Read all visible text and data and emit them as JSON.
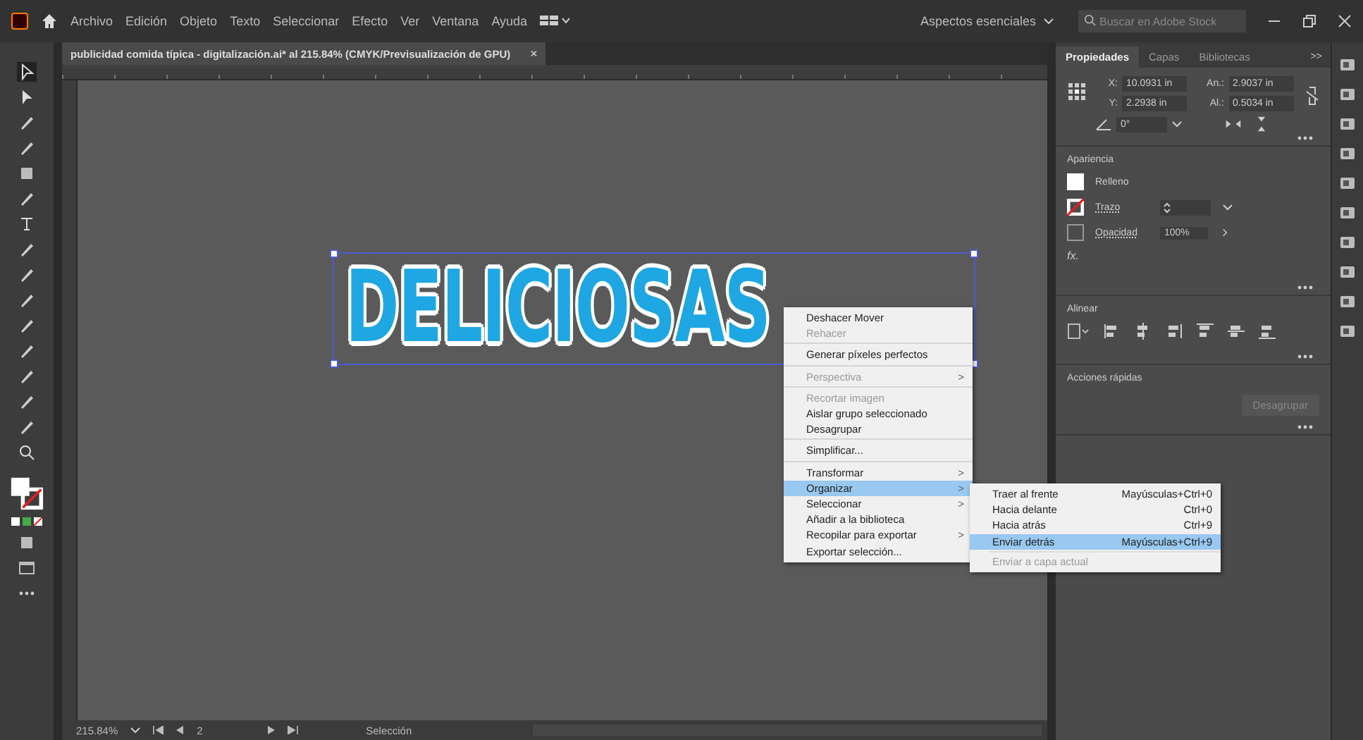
{
  "menu_bar": {
    "items": [
      "Archivo",
      "Edición",
      "Objeto",
      "Texto",
      "Seleccionar",
      "Efecto",
      "Ver",
      "Ventana",
      "Ayuda"
    ],
    "workspace": "Aspectos esenciales",
    "search": {
      "placeholder": "Buscar en Adobe Stock"
    }
  },
  "document_tab": {
    "title": "publicidad comida típica - digitalización.ai* al 215.84% (CMYK/Previsualización de GPU)",
    "close": "×"
  },
  "canvas": {
    "artwork_text": "DELICIOSAS",
    "selected": true
  },
  "context_menu": {
    "items": [
      {
        "label": "Deshacer Mover",
        "disabled": false,
        "submenu": false,
        "selected": false,
        "divider_after": false
      },
      {
        "label": "Rehacer",
        "disabled": true,
        "submenu": false,
        "selected": false,
        "divider_after": true
      },
      {
        "label": "Generar píxeles perfectos",
        "disabled": false,
        "submenu": false,
        "selected": false,
        "divider_after": true
      },
      {
        "label": "Perspectiva",
        "disabled": true,
        "submenu": true,
        "selected": false,
        "divider_after": true
      },
      {
        "label": "Recortar imagen",
        "disabled": true,
        "submenu": false,
        "selected": false,
        "divider_after": false
      },
      {
        "label": "Aislar grupo seleccionado",
        "disabled": false,
        "submenu": false,
        "selected": false,
        "divider_after": false
      },
      {
        "label": "Desagrupar",
        "disabled": false,
        "submenu": false,
        "selected": false,
        "divider_after": true
      },
      {
        "label": "Simplificar...",
        "disabled": false,
        "submenu": false,
        "selected": false,
        "divider_after": true
      },
      {
        "label": "Transformar",
        "disabled": false,
        "submenu": true,
        "selected": false,
        "divider_after": false
      },
      {
        "label": "Organizar",
        "disabled": false,
        "submenu": true,
        "selected": true,
        "divider_after": false
      },
      {
        "label": "Seleccionar",
        "disabled": false,
        "submenu": true,
        "selected": false,
        "divider_after": false
      },
      {
        "label": "Añadir a la biblioteca",
        "disabled": false,
        "submenu": false,
        "selected": false,
        "divider_after": false
      },
      {
        "label": "Recopilar para exportar",
        "disabled": false,
        "submenu": true,
        "selected": false,
        "divider_after": false
      },
      {
        "label": "Exportar selección...",
        "disabled": false,
        "submenu": false,
        "selected": false,
        "divider_after": false
      }
    ],
    "submenu_arrow": ">",
    "submenu": [
      {
        "label": "Traer al frente",
        "shortcut": "Mayúsculas+Ctrl+0",
        "disabled": false,
        "selected": false
      },
      {
        "label": "Hacia delante",
        "shortcut": "Ctrl+0",
        "disabled": false,
        "selected": false
      },
      {
        "label": "Hacia atrás",
        "shortcut": "Ctrl+9",
        "disabled": false,
        "selected": false
      },
      {
        "label": "Enviar detrás",
        "shortcut": "Mayúsculas+Ctrl+9",
        "disabled": false,
        "selected": true
      },
      {
        "label": "Enviar a capa actual",
        "disabled": true,
        "selected": false
      }
    ]
  },
  "panel": {
    "tabs": [
      {
        "label": "Propiedades",
        "selected": true
      },
      {
        "label": "Capas",
        "selected": false
      },
      {
        "label": "Bibliotecas",
        "selected": false
      }
    ],
    "collapse": ">>",
    "transform": {
      "fields": [
        {
          "label": "X:",
          "value": "10.0931 in"
        },
        {
          "label": "An.:",
          "value": "2.9037 in"
        },
        {
          "label": "Y:",
          "value": "2.2938 in"
        },
        {
          "label": "Al.:",
          "value": "0.5034 in"
        }
      ],
      "angle": "0°"
    },
    "appearance": {
      "title": "Apariencia",
      "fill": "Relleno",
      "stroke": "Trazo",
      "opacity_label": "Opacidad",
      "opacity": "100%",
      "fx": "fx."
    },
    "align": {
      "title": "Alinear"
    },
    "quick_actions": {
      "title": "Acciones rápidas",
      "button": "Desagrupar"
    }
  },
  "status_bar": {
    "zoom": "215.84%",
    "artboard": "2",
    "tool": "Selección"
  }
}
